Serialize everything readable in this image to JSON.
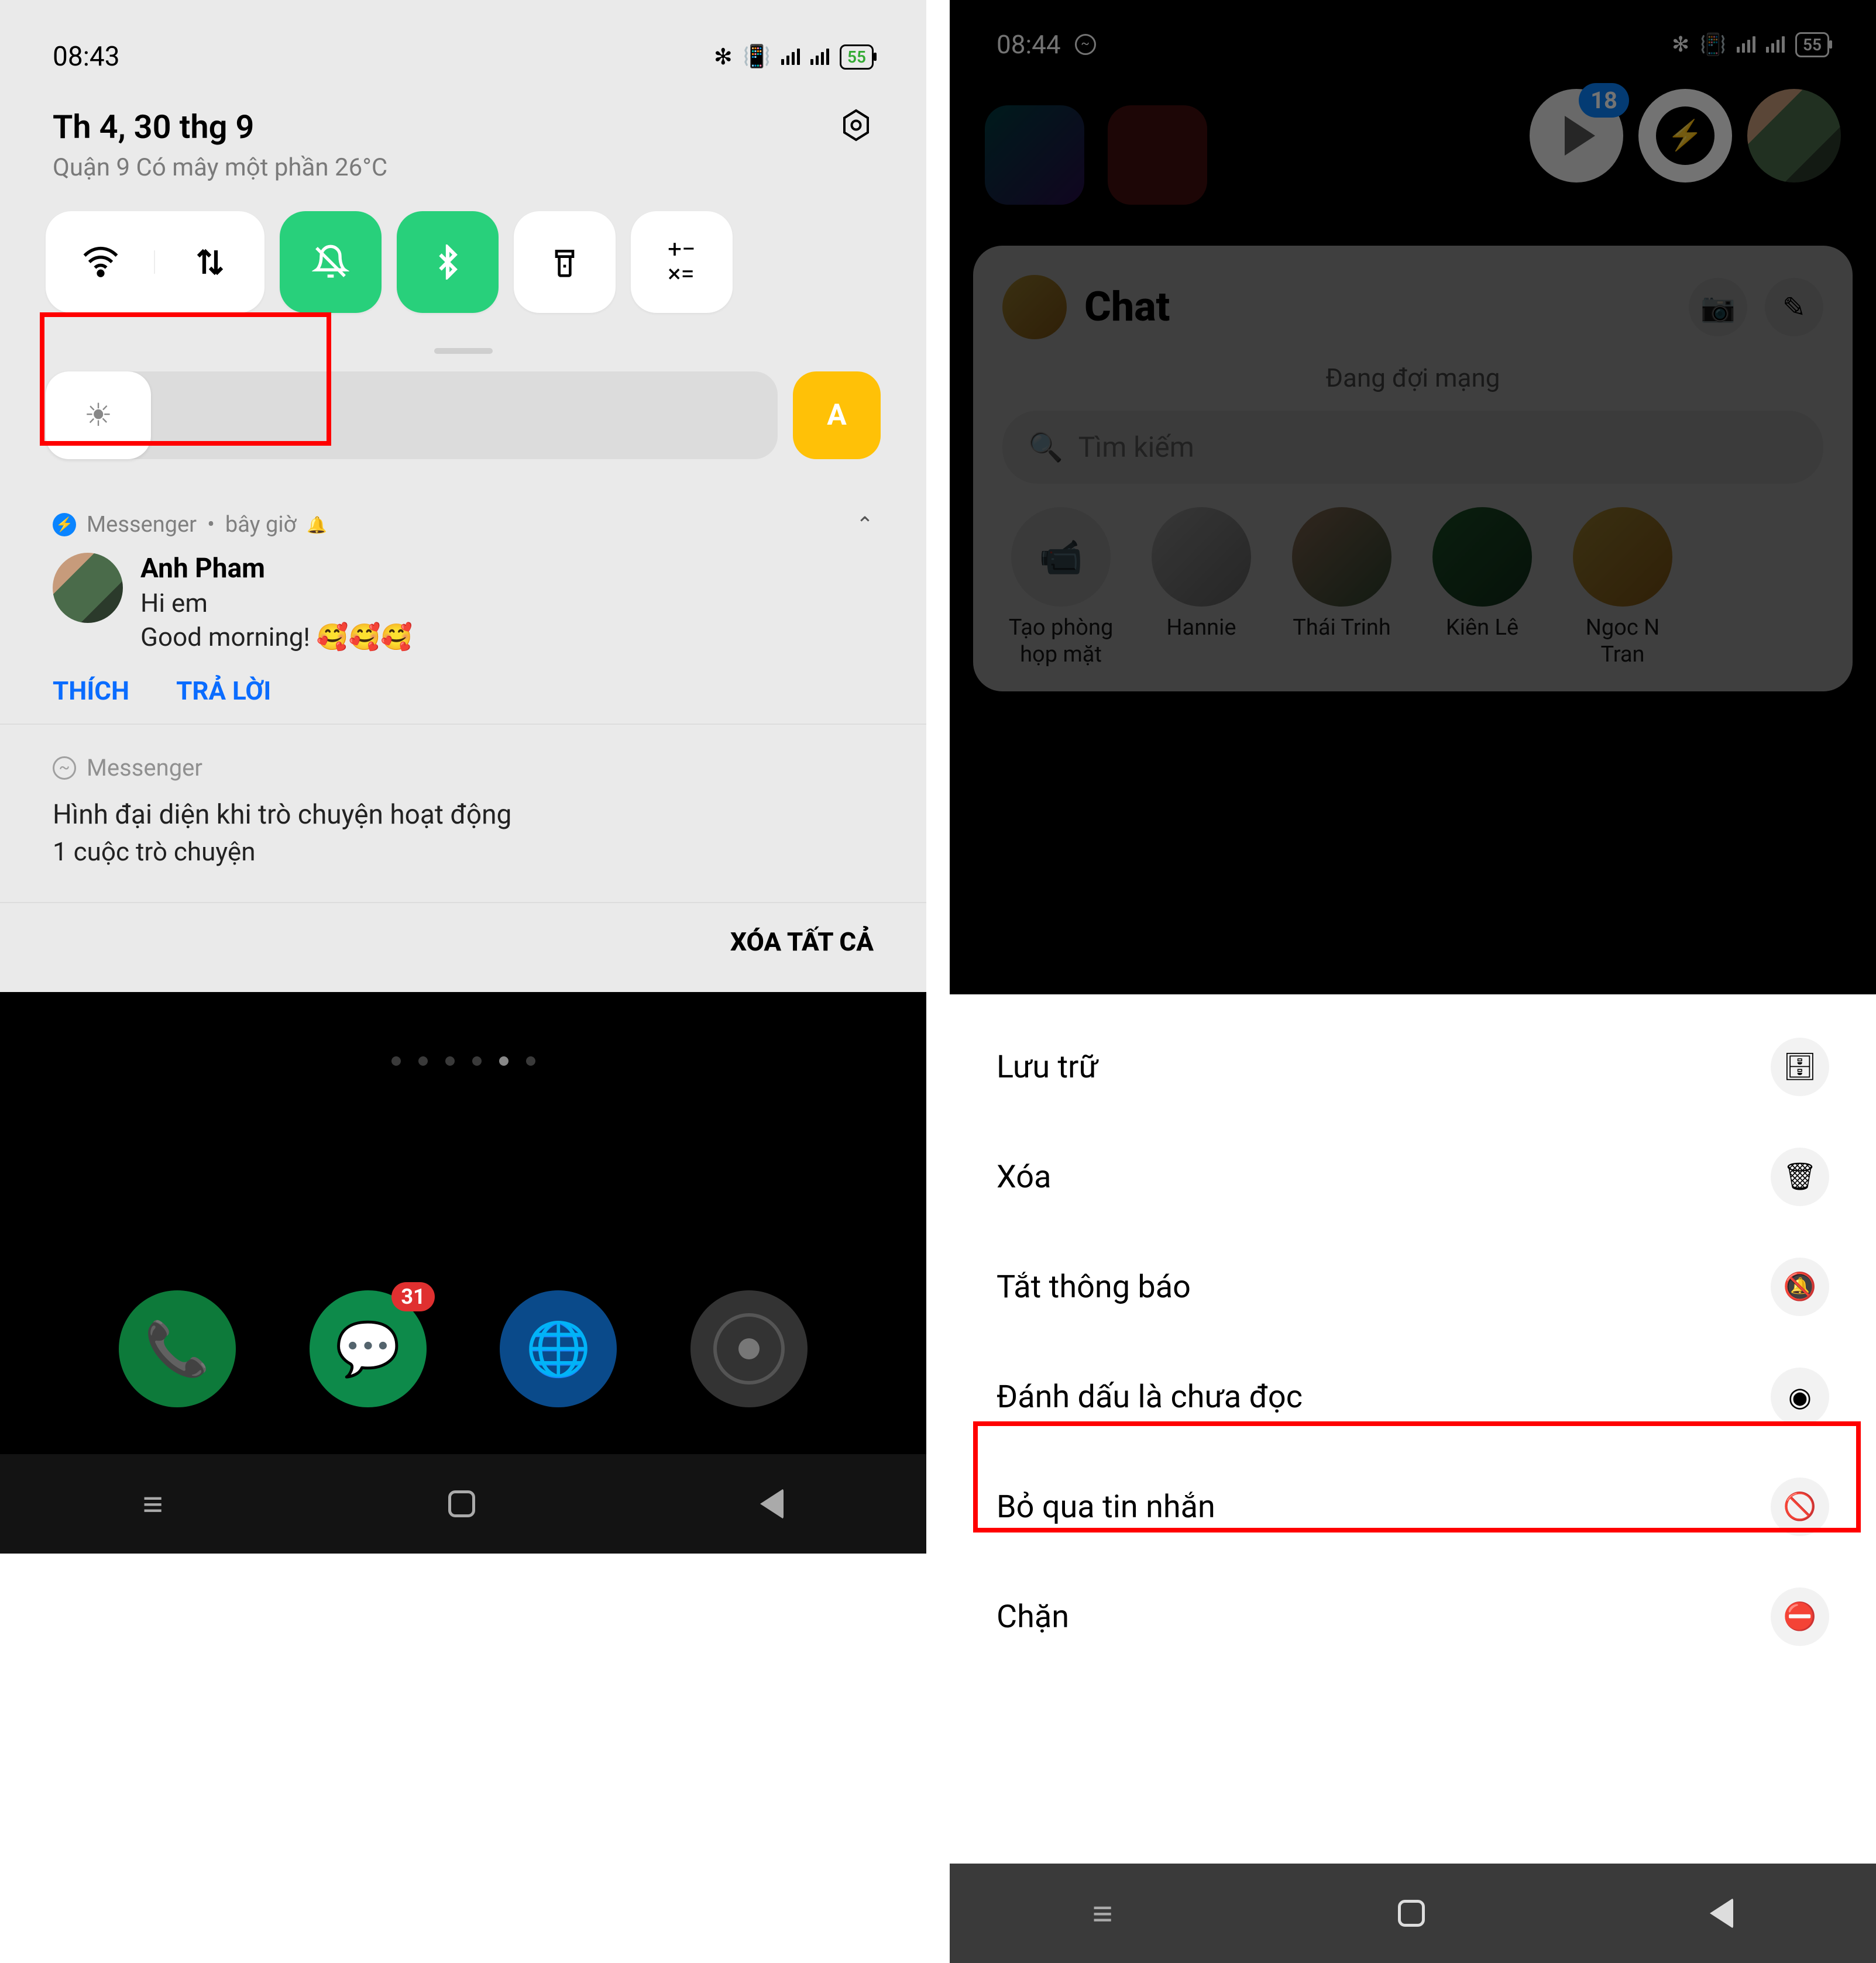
{
  "left": {
    "status_time": "08:43",
    "status_battery": "55",
    "date_main": "Th 4, 30 thg 9",
    "date_sub": "Quận 9 Có mây một phần 26°C",
    "auto_brightness": "A",
    "notif1": {
      "app": "Messenger",
      "time": "bây giờ",
      "sender": "Anh Pham",
      "line1": "Hi em",
      "line2": "Good morning! 🥰🥰🥰",
      "action_like": "THÍCH",
      "action_reply": "TRẢ LỜI"
    },
    "notif2": {
      "app": "Messenger",
      "title": "Hình đại diện khi trò chuyện hoạt động",
      "sub": "1 cuộc trò chuyện"
    },
    "clear_all": "XÓA TẤT CẢ",
    "dock_badge": "31"
  },
  "right": {
    "status_time": "08:44",
    "status_battery": "55",
    "bubble_badge": "18",
    "chat": {
      "title": "Chat",
      "waiting": "Đang đợi mạng",
      "search": "Tìm kiếm",
      "stories": [
        {
          "label": "Tạo phòng họp mặt"
        },
        {
          "label": "Hannie"
        },
        {
          "label": "Thái Trinh"
        },
        {
          "label": "Kiên Lê"
        },
        {
          "label": "Ngoc N Tran"
        }
      ]
    },
    "sheet": [
      {
        "label": "Lưu trữ"
      },
      {
        "label": "Xóa"
      },
      {
        "label": "Tắt thông báo"
      },
      {
        "label": "Đánh dấu là chưa đọc"
      },
      {
        "label": "Bỏ qua tin nhắn"
      },
      {
        "label": "Chặn"
      }
    ]
  }
}
